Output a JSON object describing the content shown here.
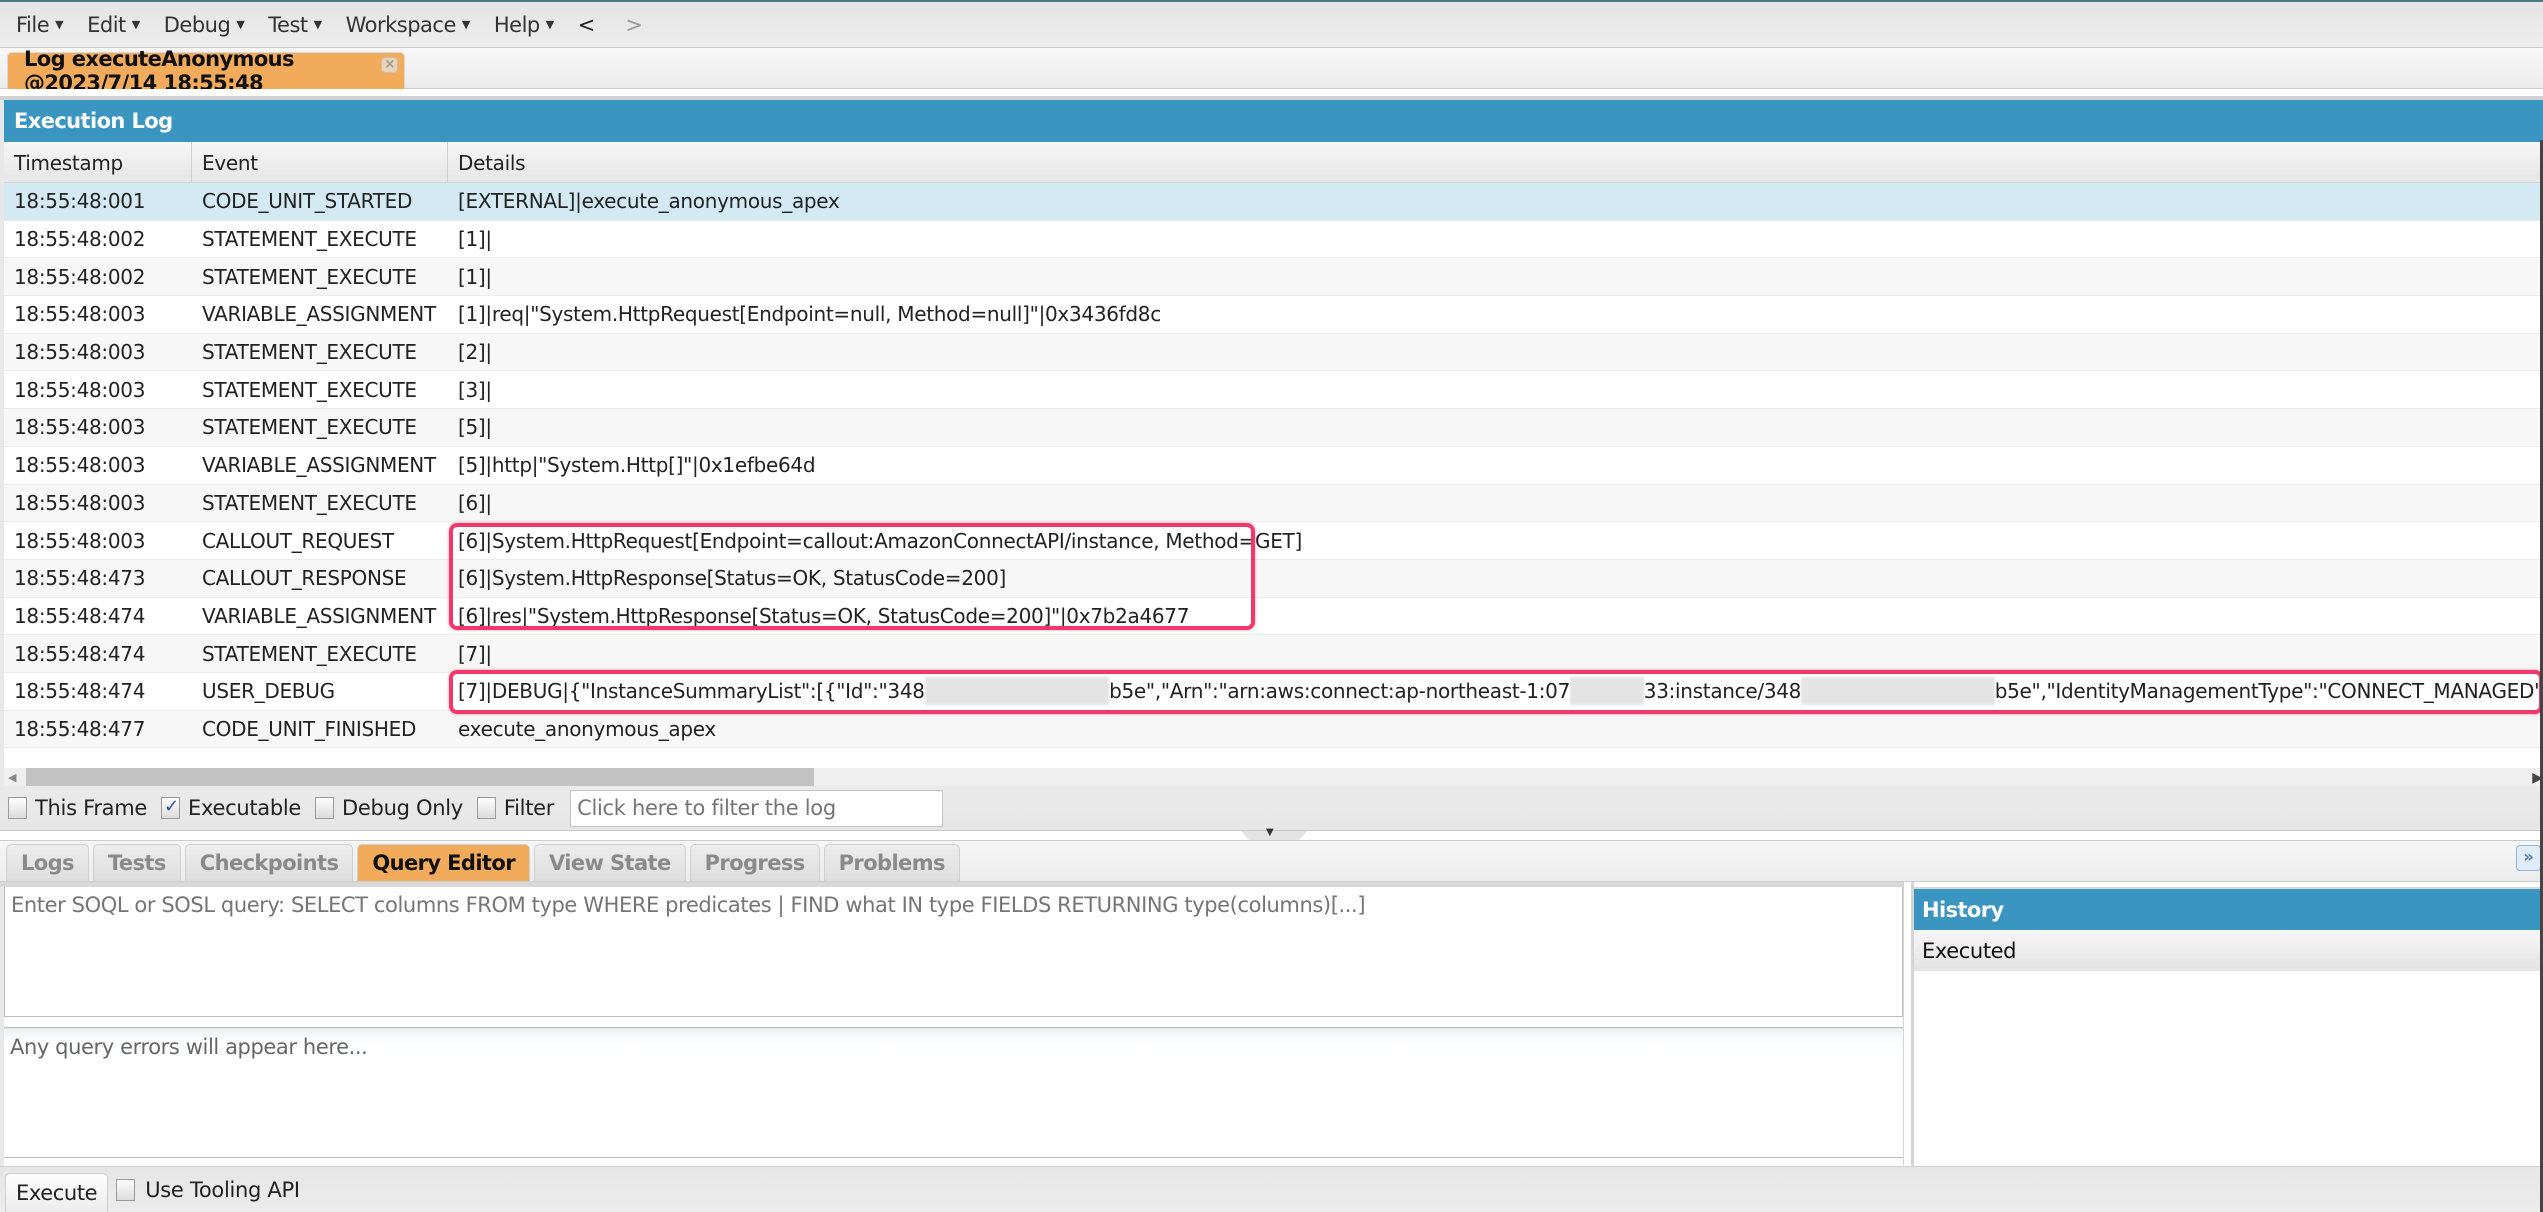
{
  "menubar": {
    "items": [
      "File",
      "Edit",
      "Debug",
      "Test",
      "Workspace",
      "Help"
    ],
    "back": "<",
    "forward": ">"
  },
  "tab": {
    "title": "Log executeAnonymous @2023/7/14 18:55:48",
    "close": "×"
  },
  "execution_log": {
    "title": "Execution Log",
    "columns": [
      "Timestamp",
      "Event",
      "Details"
    ],
    "rows": [
      {
        "timestamp": "18:55:48:001",
        "event": "CODE_UNIT_STARTED",
        "details": "[EXTERNAL]|execute_anonymous_apex",
        "selected": true
      },
      {
        "timestamp": "18:55:48:002",
        "event": "STATEMENT_EXECUTE",
        "details": "[1]|"
      },
      {
        "timestamp": "18:55:48:002",
        "event": "STATEMENT_EXECUTE",
        "details": "[1]|"
      },
      {
        "timestamp": "18:55:48:003",
        "event": "VARIABLE_ASSIGNMENT",
        "details": "[1]|req|\"System.HttpRequest[Endpoint=null, Method=null]\"|0x3436fd8c"
      },
      {
        "timestamp": "18:55:48:003",
        "event": "STATEMENT_EXECUTE",
        "details": "[2]|"
      },
      {
        "timestamp": "18:55:48:003",
        "event": "STATEMENT_EXECUTE",
        "details": "[3]|"
      },
      {
        "timestamp": "18:55:48:003",
        "event": "STATEMENT_EXECUTE",
        "details": "[5]|"
      },
      {
        "timestamp": "18:55:48:003",
        "event": "VARIABLE_ASSIGNMENT",
        "details": "[5]|http|\"System.Http[]\"|0x1efbe64d"
      },
      {
        "timestamp": "18:55:48:003",
        "event": "STATEMENT_EXECUTE",
        "details": "[6]|"
      },
      {
        "timestamp": "18:55:48:003",
        "event": "CALLOUT_REQUEST",
        "details": "[6]|System.HttpRequest[Endpoint=callout:AmazonConnectAPI/instance, Method=GET]"
      },
      {
        "timestamp": "18:55:48:473",
        "event": "CALLOUT_RESPONSE",
        "details": "[6]|System.HttpResponse[Status=OK, StatusCode=200]"
      },
      {
        "timestamp": "18:55:48:474",
        "event": "VARIABLE_ASSIGNMENT",
        "details": "[6]|res|\"System.HttpResponse[Status=OK, StatusCode=200]\"|0x7b2a4677"
      },
      {
        "timestamp": "18:55:48:474",
        "event": "STATEMENT_EXECUTE",
        "details": "[7]|"
      },
      {
        "timestamp": "18:55:48:474",
        "event": "USER_DEBUG",
        "details_parts": [
          "[7]|DEBUG|{\"InstanceSummaryList\":[{\"Id\":\"348",
          "[redacted]",
          "b5e\",\"Arn\":\"arn:aws:connect:ap-northeast-1:07",
          "[redacted]",
          "33:instance/348",
          "[redacted]",
          "b5e\",\"IdentityManagementType\":\"CONNECT_MANAGED\""
        ]
      },
      {
        "timestamp": "18:55:48:477",
        "event": "CODE_UNIT_FINISHED",
        "details": "execute_anonymous_apex"
      }
    ]
  },
  "filterbar": {
    "this_frame": {
      "label": "This Frame",
      "checked": false
    },
    "executable": {
      "label": "Executable",
      "checked": true
    },
    "debug_only": {
      "label": "Debug Only",
      "checked": false
    },
    "filter": {
      "label": "Filter",
      "checked": false
    },
    "filter_placeholder": "Click here to filter the log"
  },
  "bottom_tabs": {
    "items": [
      "Logs",
      "Tests",
      "Checkpoints",
      "Query Editor",
      "View State",
      "Progress",
      "Problems"
    ],
    "active": "Query Editor"
  },
  "query_editor": {
    "query_placeholder": "Enter SOQL or SOSL query: SELECT columns FROM type WHERE predicates | FIND what IN type FIELDS RETURNING type(columns)[...]",
    "errors_placeholder": "Any query errors will appear here..."
  },
  "history": {
    "title": "History",
    "column": "Executed"
  },
  "footer": {
    "execute_label": "Execute",
    "tooling_label": "Use Tooling API",
    "tooling_checked": false
  },
  "colors": {
    "accent_blue": "#3a96c0",
    "active_tab_orange": "#f2ab5a",
    "highlight_pink": "#f0386a",
    "selected_row": "#d3eaf4"
  }
}
